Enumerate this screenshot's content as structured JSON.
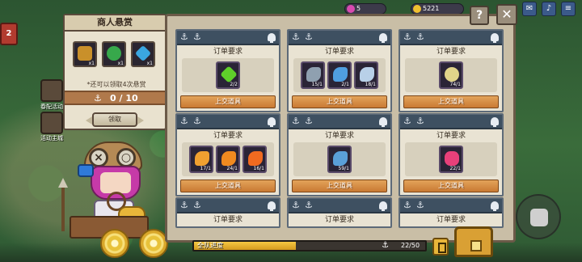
{
  "hud": {
    "left_badge": "2",
    "res1_value": "5",
    "res2_value": "5221",
    "side_label_1": "春配活动",
    "side_label_2": "活动主城"
  },
  "bounty": {
    "title": "商人悬赏",
    "items": [
      {
        "icon": "scroll-icon",
        "count": "x1",
        "color": "#c9902a"
      },
      {
        "icon": "green-swirl-icon",
        "count": "x1",
        "color": "#37a84b"
      },
      {
        "icon": "blue-gem-icon",
        "count": "x1",
        "color": "#3aa7e0"
      }
    ],
    "note": "*还可以领取4次悬赏",
    "progress_value": "0 / 10",
    "claim_label": "领取"
  },
  "orders": {
    "title": "订单要求",
    "submit_label": "上交道具",
    "cards": [
      {
        "items": [
          {
            "icon": "green-crystal-icon",
            "count": "2/2",
            "color": "#5fcf2a"
          }
        ]
      },
      {
        "items": [
          {
            "icon": "grey-fish-icon",
            "count": "15/1",
            "color": "#8fa0b0"
          },
          {
            "icon": "blue-fish-icon",
            "count": "2/1",
            "color": "#4f9ee0"
          },
          {
            "icon": "silver-fish-icon",
            "count": "18/1",
            "color": "#b8d0e8"
          }
        ]
      },
      {
        "items": [
          {
            "icon": "pufferfish-icon",
            "count": "74/1",
            "color": "#e0d48a"
          }
        ]
      },
      {
        "items": [
          {
            "icon": "orange-fish-icon",
            "count": "17/1",
            "color": "#f0a030"
          },
          {
            "icon": "goldfish-icon",
            "count": "24/1",
            "color": "#f08a20"
          },
          {
            "icon": "red-goldfish-icon",
            "count": "16/1",
            "color": "#f06a20"
          }
        ]
      },
      {
        "items": [
          {
            "icon": "mackerel-icon",
            "count": "59/1",
            "color": "#5aa0d8"
          }
        ]
      },
      {
        "items": [
          {
            "icon": "pink-coral-icon",
            "count": "22/1",
            "color": "#e8407a"
          }
        ]
      },
      {
        "items": []
      },
      {
        "items": []
      },
      {
        "items": []
      }
    ]
  },
  "team_progress": {
    "label": "全队进度",
    "count": "22/50",
    "fraction": 0.44
  },
  "buttons": {
    "help": "?",
    "close": "✕"
  }
}
